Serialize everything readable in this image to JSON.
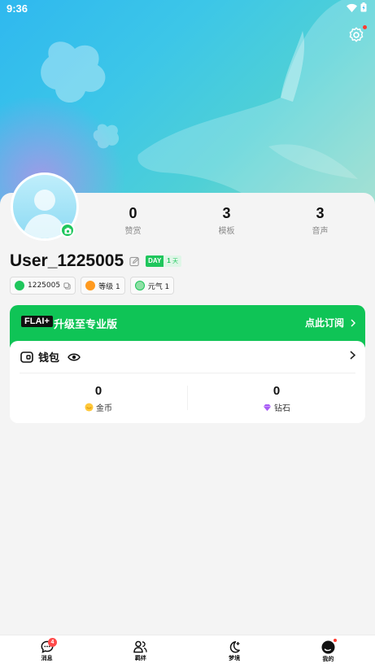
{
  "status_bar": {
    "time": "9:36"
  },
  "profile": {
    "username": "User_1225005",
    "day_badge": {
      "label": "DAY",
      "value": "1",
      "unit": "天"
    },
    "stats": [
      {
        "value": "0",
        "label": "赞赏"
      },
      {
        "value": "3",
        "label": "模板"
      },
      {
        "value": "3",
        "label": "音声"
      }
    ],
    "chips": [
      {
        "icon": "id-icon",
        "text": "1225005",
        "color": "#1fc65c"
      },
      {
        "icon": "level-icon",
        "text": "等级 1",
        "color": "#ff9a1f"
      },
      {
        "icon": "energy-icon",
        "text": "元气 1",
        "color": "#1fc65c"
      }
    ]
  },
  "promo": {
    "tag": "FLAI+",
    "title": "升级至专业版",
    "cta": "点此订阅"
  },
  "wallet": {
    "title": "钱包",
    "items": [
      {
        "value": "0",
        "label": "金币",
        "icon": "coin-icon"
      },
      {
        "value": "0",
        "label": "钻石",
        "icon": "diamond-icon"
      }
    ]
  },
  "nav": {
    "items": [
      {
        "label": "消息",
        "icon": "message-icon",
        "badge": "4"
      },
      {
        "label": "羁绊",
        "icon": "friends-icon"
      },
      {
        "label": "梦境",
        "icon": "moon-icon"
      },
      {
        "label": "我的",
        "icon": "profile-icon"
      }
    ]
  },
  "colors": {
    "accent": "#0fc456",
    "sky": "#2fb8ef",
    "badge": "#ff4a4a"
  }
}
